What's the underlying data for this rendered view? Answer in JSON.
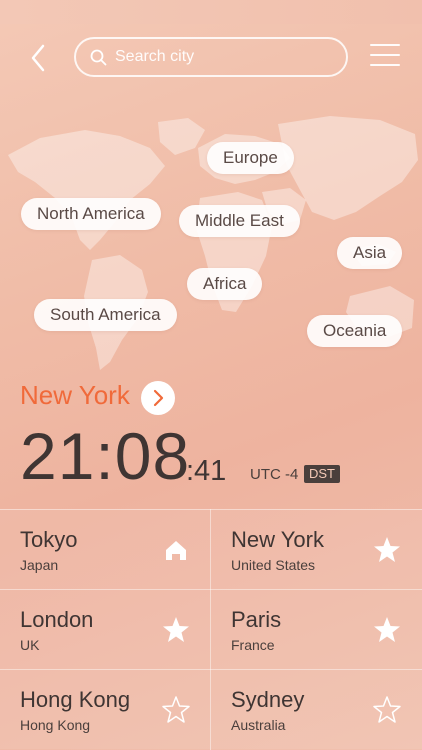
{
  "header": {
    "search_placeholder": "Search city"
  },
  "regions": [
    "Europe",
    "North America",
    "Middle East",
    "Asia",
    "Africa",
    "South America",
    "Oceania"
  ],
  "current": {
    "city": "New York",
    "time_hm": "21:08",
    "time_sec": ":41",
    "utc_offset": "UTC -4",
    "dst_badge": "DST"
  },
  "cities": [
    {
      "name": "Tokyo",
      "country": "Japan",
      "icon": "home-icon",
      "favorite": true
    },
    {
      "name": "New York",
      "country": "United States",
      "icon": "star-filled-icon",
      "favorite": true
    },
    {
      "name": "London",
      "country": "UK",
      "icon": "star-filled-icon",
      "favorite": true
    },
    {
      "name": "Paris",
      "country": "France",
      "icon": "star-filled-icon",
      "favorite": true
    },
    {
      "name": "Hong Kong",
      "country": "Hong Kong",
      "icon": "star-outline-icon",
      "favorite": false
    },
    {
      "name": "Sydney",
      "country": "Australia",
      "icon": "star-outline-icon",
      "favorite": false
    }
  ],
  "colors": {
    "accent": "#f06a3a",
    "background": "#f0bca7",
    "text": "#3f3533"
  }
}
